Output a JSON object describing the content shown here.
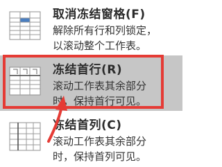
{
  "menu": {
    "items": [
      {
        "title": "取消冻结窗格(F)",
        "desc_lines": [
          "解除所有行和列锁定，",
          "以滚动整个工作表。"
        ],
        "icon": "unfreeze-panes-icon"
      },
      {
        "title": "冻结首行(R)",
        "desc_lines": [
          "滚动工作表其余部分",
          "时，保持首行可见。"
        ],
        "icon": "freeze-top-row-icon",
        "selected": true
      },
      {
        "title": "冻结首列(C)",
        "desc_lines": [
          "滚动工作表其余部分",
          "时，保持首列可见。"
        ],
        "icon": "freeze-first-column-icon"
      }
    ]
  },
  "colors": {
    "highlight_bg": "#c6c6c6",
    "annotation_red": "#e53b35",
    "icon_blue": "#4a7fc1",
    "text": "#2b2b2b"
  }
}
